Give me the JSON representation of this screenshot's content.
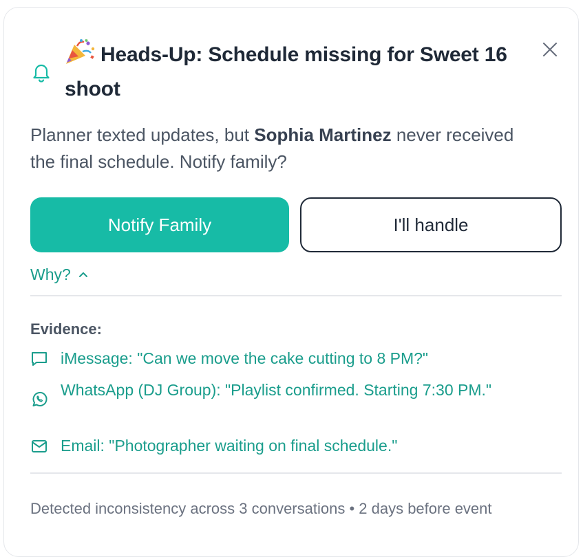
{
  "notification": {
    "title": "Heads-Up: Schedule missing for Sweet 16 shoot",
    "emoji_icon": "party-popper-icon",
    "body_prefix": "Planner texted updates, but ",
    "body_name": "Sophia Martinez",
    "body_suffix": " never received the final schedule. Notify family?",
    "primary_button": "Notify Family",
    "secondary_button": "I'll handle",
    "why_label": "Why?",
    "evidence_heading": "Evidence:",
    "evidence": [
      {
        "icon": "message-bubble-icon",
        "text": "iMessage: \"Can we move the cake cutting to 8 PM?\""
      },
      {
        "icon": "whatsapp-icon",
        "text": "WhatsApp (DJ Group): \"Playlist confirmed. Starting 7:30 PM.\""
      },
      {
        "icon": "mail-icon",
        "text": "Email: \"Photographer waiting on final schedule.\""
      }
    ],
    "footer": "Detected inconsistency across 3 conversations • 2 days before event"
  },
  "colors": {
    "accent": "#17bba6",
    "accent_text": "#1a9d8c",
    "title_text": "#1f2937",
    "body_text": "#4b5563",
    "muted_text": "#6b7280",
    "divider": "#e5e7eb"
  }
}
